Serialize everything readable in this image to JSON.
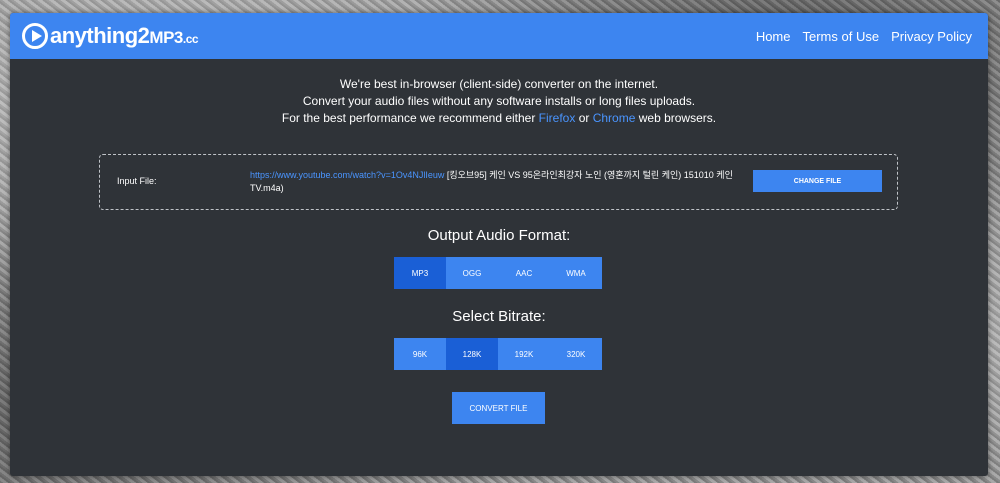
{
  "header": {
    "logo_main": "anything",
    "logo_two": "2",
    "logo_mp3": "MP3",
    "logo_cc": ".cc",
    "nav": [
      "Home",
      "Terms of Use",
      "Privacy Policy"
    ]
  },
  "intro": {
    "line1": "We're best in-browser (client-side) converter on the internet.",
    "line2": "Convert your audio files without any software installs or long files uploads.",
    "line3_prefix": "For the best performance we recommend either ",
    "firefox": "Firefox",
    "or": " or ",
    "chrome": "Chrome",
    "line3_suffix": " web browsers."
  },
  "input": {
    "label": "Input File:",
    "url": "https://www.youtube.com/watch?v=1Ov4NJlIeuw",
    "filename": " [킹오브95] 케인 VS 95온라인최강자 노인 (영혼까지 털린 케인) 151010 케인 TV.m4a)",
    "change_button": "CHANGE FILE"
  },
  "format": {
    "title": "Output Audio Format:",
    "options": [
      "MP3",
      "OGG",
      "AAC",
      "WMA"
    ],
    "selected": "MP3"
  },
  "bitrate": {
    "title": "Select Bitrate:",
    "options": [
      "96K",
      "128K",
      "192K",
      "320K"
    ],
    "selected": "128K"
  },
  "convert_button": "CONVERT FILE",
  "colors": {
    "accent": "#3d85f0",
    "selected": "#1a5fd6",
    "panel": "#2f3338",
    "link": "#4a95ff"
  }
}
